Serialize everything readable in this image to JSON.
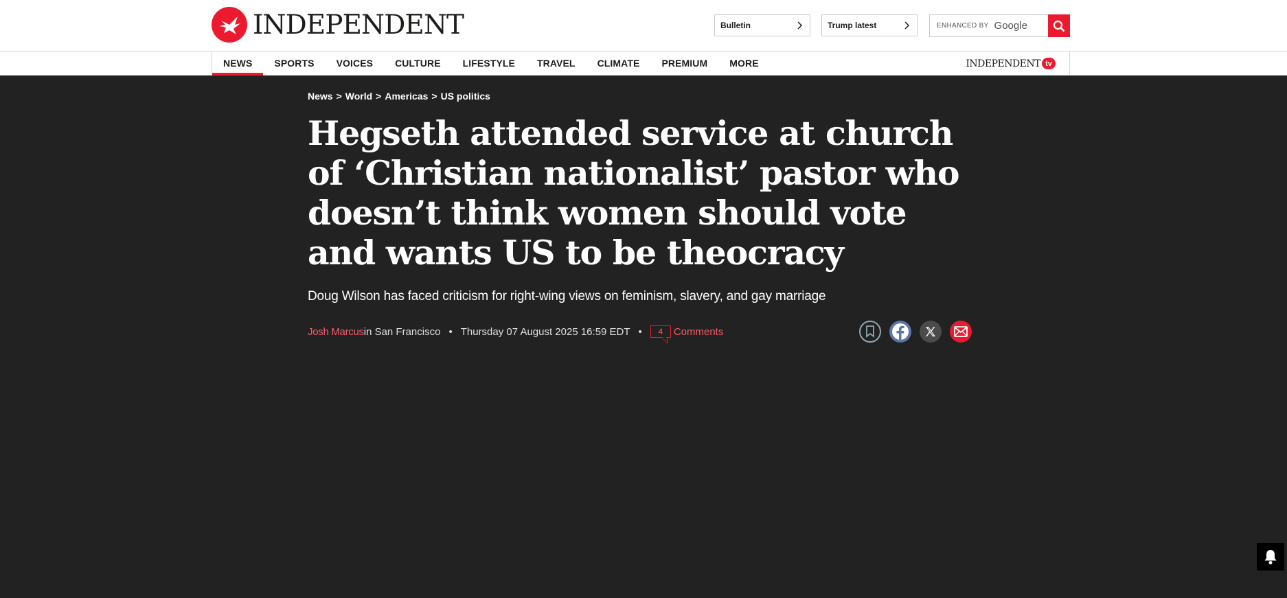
{
  "header": {
    "logo_text": "INDEPENDENT",
    "pills": [
      {
        "label": "Bulletin"
      },
      {
        "label": "Trump latest"
      }
    ],
    "search": {
      "enhanced_by": "ENHANCED BY",
      "provider": "Google",
      "icon": "search-icon"
    }
  },
  "nav": {
    "items": [
      {
        "label": "NEWS",
        "active": true
      },
      {
        "label": "SPORTS"
      },
      {
        "label": "VOICES"
      },
      {
        "label": "CULTURE"
      },
      {
        "label": "LIFESTYLE"
      },
      {
        "label": "TRAVEL"
      },
      {
        "label": "CLIMATE"
      },
      {
        "label": "PREMIUM"
      },
      {
        "label": "MORE"
      }
    ],
    "tv_logo_text": "INDEPENDENT",
    "tv_badge": "tv"
  },
  "article": {
    "breadcrumb": [
      "News",
      "World",
      "Americas",
      "US politics"
    ],
    "breadcrumb_sep": ">",
    "headline": "Hegseth attended service at church of ‘Christian nationalist’ pastor who doesn’t think women should vote and wants US to be theocracy",
    "standfirst": "Doug Wilson has faced criticism for right-wing views on feminism, slavery, and gay marriage",
    "author": "Josh Marcus",
    "location": " in San Francisco",
    "date": "Thursday 07 August 2025 16:59 EDT",
    "comment_count": "4",
    "comments_label": "Comments"
  },
  "share": [
    "bookmark-icon",
    "facebook-icon",
    "x-icon",
    "email-icon"
  ],
  "colors": {
    "brand_red": "#ec1a2e",
    "background": "#222222",
    "link_red": "#f25d6b"
  }
}
